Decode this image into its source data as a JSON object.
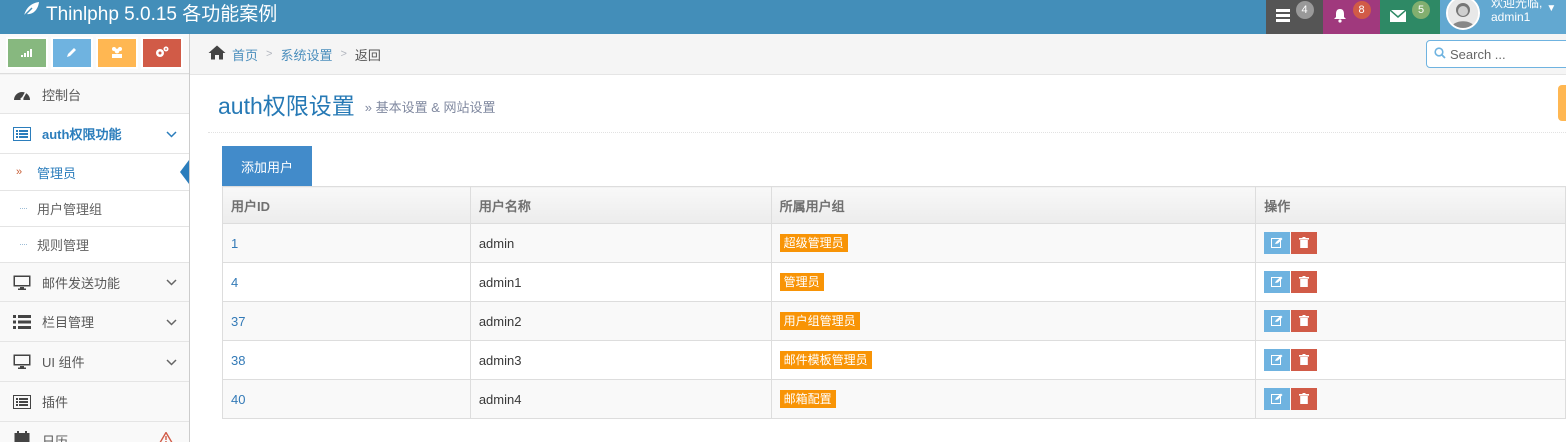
{
  "app": {
    "title": "Thinlphp 5.0.15 各功能案例"
  },
  "navbar": {
    "tasks": {
      "count": "4",
      "color": "#555555",
      "badge_color": "#999999"
    },
    "notifications": {
      "count": "8",
      "color": "#a0397d",
      "badge_color": "#d15b47"
    },
    "messages": {
      "count": "5",
      "color": "#2e8965",
      "badge_color": "#82af6f"
    },
    "user": {
      "greeting": "欢迎光临,",
      "name": "admin1"
    }
  },
  "sidebar": {
    "shortcuts": [
      {
        "icon": "signal-icon",
        "color": "#87b87f"
      },
      {
        "icon": "pencil-icon",
        "color": "#6fb3e0"
      },
      {
        "icon": "group-icon",
        "color": "#ffb752"
      },
      {
        "icon": "cogs-icon",
        "color": "#d15b47"
      }
    ],
    "items": [
      {
        "label": "控制台"
      },
      {
        "label": "auth权限功能"
      },
      {
        "label": "邮件发送功能"
      },
      {
        "label": "栏目管理"
      },
      {
        "label": "UI 组件"
      },
      {
        "label": "插件"
      },
      {
        "label": "日历"
      }
    ],
    "submenu": [
      {
        "label": "管理员"
      },
      {
        "label": "用户管理组"
      },
      {
        "label": "规则管理"
      }
    ]
  },
  "breadcrumb": {
    "home": "首页",
    "section": "系统设置",
    "current": "返回"
  },
  "search": {
    "placeholder": "Search ..."
  },
  "page": {
    "title": "auth权限设置",
    "subtitle": "» 基本设置 & 网站设置",
    "add_button": "添加用户"
  },
  "table": {
    "headers": [
      "用户ID",
      "用户名称",
      "所属用户组",
      "操作"
    ],
    "rows": [
      {
        "id": "1",
        "name": "admin",
        "group": "超级管理员"
      },
      {
        "id": "4",
        "name": "admin1",
        "group": "管理员"
      },
      {
        "id": "37",
        "name": "admin2",
        "group": "用户组管理员"
      },
      {
        "id": "38",
        "name": "admin3",
        "group": "邮件模板管理员"
      },
      {
        "id": "40",
        "name": "admin4",
        "group": "邮箱配置"
      }
    ]
  }
}
